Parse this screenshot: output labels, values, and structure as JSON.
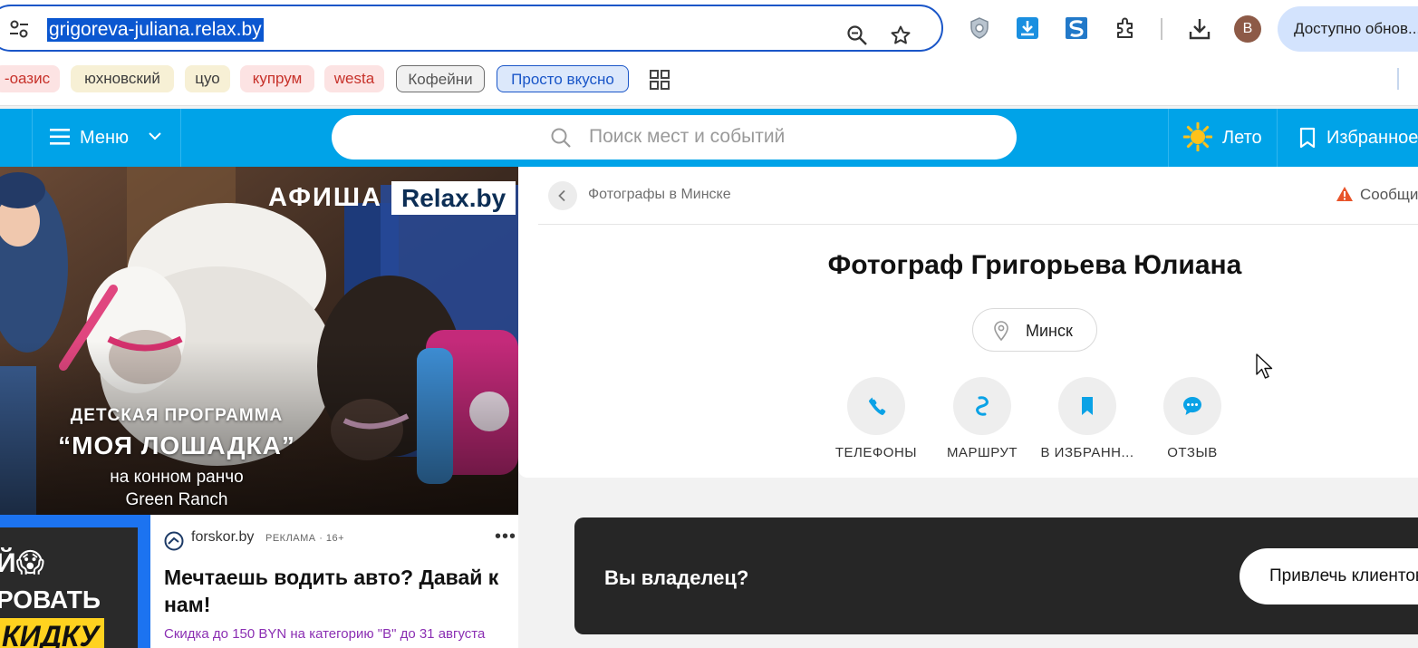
{
  "browser": {
    "url": "grigoreva-juliana.relax.by",
    "profile_initial": "B",
    "update_label": "Доступно обнов..."
  },
  "bookmarks": [
    {
      "label": "-оазис"
    },
    {
      "label": "юхновский"
    },
    {
      "label": "цуо"
    },
    {
      "label": "купрум"
    },
    {
      "label": "westa"
    },
    {
      "label": "Кофейни"
    },
    {
      "label": "Просто вкусно"
    }
  ],
  "site_header": {
    "menu_label": "Меню",
    "search_placeholder": "Поиск мест и событий",
    "season_label": "Лето",
    "favorites_label": "Избранное"
  },
  "promo": {
    "brand_left": "АФИША",
    "brand_right": "Relax.by",
    "line1": "ДЕТСКАЯ ПРОГРАММА",
    "line2": "“МОЯ ЛОШАДКА”",
    "line3": "на конном ранчо",
    "line4": "Green Ranch"
  },
  "ad": {
    "image_text_top": "Й😱",
    "image_text_mid": "РОВАТЬ",
    "image_text_bottom": "КИДКУ",
    "source": "forskor.by",
    "tag": "РЕКЛАМА · 16+",
    "title": "Мечтаешь водить авто? Давай к нам!",
    "text": "Скидка до 150 BYN на категорию \"В\" до 31 августа"
  },
  "company": {
    "breadcrumb": "Фотографы в Минске",
    "report_label": "Сообщи",
    "title": "Фотограф Григорьева Юлиана",
    "city": "Минск",
    "actions": [
      {
        "label": "ТЕЛЕФОНЫ",
        "icon": "phone-icon"
      },
      {
        "label": "МАРШРУТ",
        "icon": "route-icon"
      },
      {
        "label": "В ИЗБРАНН...",
        "icon": "bookmark-icon"
      },
      {
        "label": "ОТЗЫВ",
        "icon": "chat-bubble-icon"
      }
    ]
  },
  "owner": {
    "title": "Вы владелец?",
    "button_label": "Привлечь клиентов"
  },
  "colors": {
    "header_blue": "#00a3e8",
    "chrome_focus": "#1a56c8",
    "action_blue": "#0aa2e6",
    "ad_text_purple": "#8b2fb3",
    "dark_block": "#262626"
  }
}
